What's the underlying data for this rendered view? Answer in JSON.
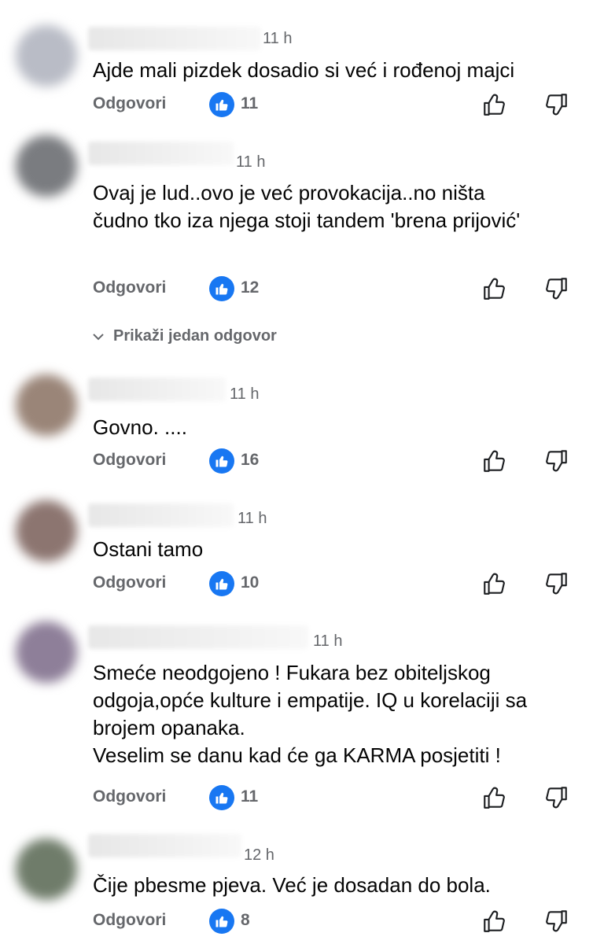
{
  "reply_label": "Odgovori",
  "show_replies_label": "Prikaži jedan odgovor",
  "colors": {
    "like_badge": "#1877f2",
    "muted_text": "#65676b"
  },
  "comments": [
    {
      "time": "11 h",
      "text": "Ajde mali pizdek dosadio si već i rođenoj majci",
      "likes": "11"
    },
    {
      "time": "11 h",
      "text": "Ovaj je lud..ovo je već provokacija..no ništa čudno tko iza njega stoji tandem 'brena prijović'",
      "likes": "12"
    },
    {
      "time": "11 h",
      "text": "Govno. ....",
      "likes": "16"
    },
    {
      "time": "11 h",
      "text": "Ostani tamo",
      "likes": "10"
    },
    {
      "time": "11 h",
      "text": "Smeće neodgojeno ! Fukara bez obiteljskog odgoja,opće kulture i empatije. IQ u korelaciji sa brojem opanaka.\nVeselim se danu kad će ga KARMA posjetiti !",
      "likes": "11"
    },
    {
      "time": "12 h",
      "text": "Čije pbesme pjeva. Već je dosadan do bola.",
      "likes": "8"
    }
  ]
}
